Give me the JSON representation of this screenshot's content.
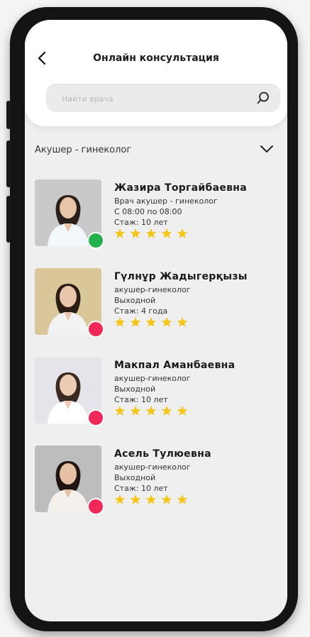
{
  "header": {
    "title": "Онлайн консультация",
    "search_placeholder": "Найти врача"
  },
  "filter": {
    "category": "Акушер - гинеколог"
  },
  "colors": {
    "online": "#22b14c",
    "offline": "#f2275a",
    "star": "#f5c518"
  },
  "doctors": [
    {
      "name": "Жазира Торгайбаевна",
      "specialty": "Врач акушер - гинеколог",
      "schedule": "С 08:00 по 08:00",
      "experience": "Стаж: 10 лет",
      "status": "online",
      "rating": 5
    },
    {
      "name": "Гүлнұр Жадыгерқызы",
      "specialty": "акушер-гинеколог",
      "schedule": "Выходной",
      "experience": "Стаж: 4 года",
      "status": "offline",
      "rating": 5
    },
    {
      "name": "Макпал Аманбаевна",
      "specialty": "акушер-гинеколог",
      "schedule": "Выходной",
      "experience": "Стаж: 10 лет",
      "status": "offline",
      "rating": 5
    },
    {
      "name": "Асель Тулюевна",
      "specialty": "акушер-гинеколог",
      "schedule": "Выходной",
      "experience": "Стаж: 10 лет",
      "status": "offline",
      "rating": 5
    }
  ]
}
